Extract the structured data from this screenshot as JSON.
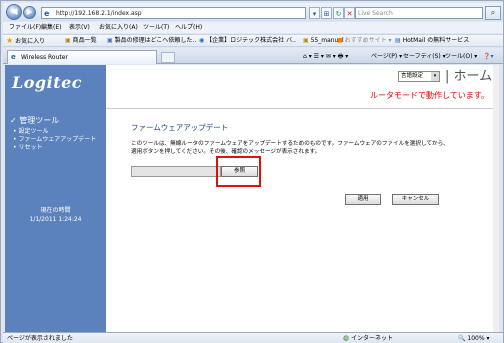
{
  "browser": {
    "url": "http://192.168.2.1/index.asp",
    "search_placeholder": "Live Search",
    "nav_back_glyph": "◀",
    "nav_forward_glyph": "▶",
    "menu": [
      "ファイル(F)",
      "編集(E)",
      "表示(V)",
      "お気に入り(A)",
      "ツール(T)",
      "ヘルプ(H)"
    ],
    "favorites": {
      "label": "お気に入り",
      "items": [
        "商品一覧",
        "製品の修理はどこへ依頼した..",
        "【企業】ロジテック株式会社 バ..",
        "55_manual",
        "おすすめサイト ▾",
        "HotMail の無料サービス"
      ]
    },
    "tab_title": "Wireless Router",
    "commands": [
      "ページ(P) ▾",
      "セーフティ(S) ▾",
      "ツール(O) ▾"
    ],
    "status_text": "ページが表示されました",
    "zone_text": "インターネット",
    "zoom_text": "100%"
  },
  "router": {
    "logo_text": "Logitec",
    "language_select": "言語設定",
    "home_label": "ホーム",
    "mode_text": "ルータモードで動作しています。",
    "sidebar": {
      "title": "管理ツール",
      "links": [
        "設定ツール",
        "ファームウェアアップデート",
        "リセット"
      ],
      "time_label": "現在の時間",
      "time_value": "1/1/2011 1:24:24"
    },
    "page_title": "ファームウェアアップデート",
    "description": "このツールは、無線ルータのファームウェアをアップデートするためのものです。ファームウェアのファイルを選択してから、適用ボタンを押してください。その後、確認のメッセージが表示されます。",
    "browse_label": "参照",
    "apply_label": "適用",
    "cancel_label": "キャンセル"
  }
}
